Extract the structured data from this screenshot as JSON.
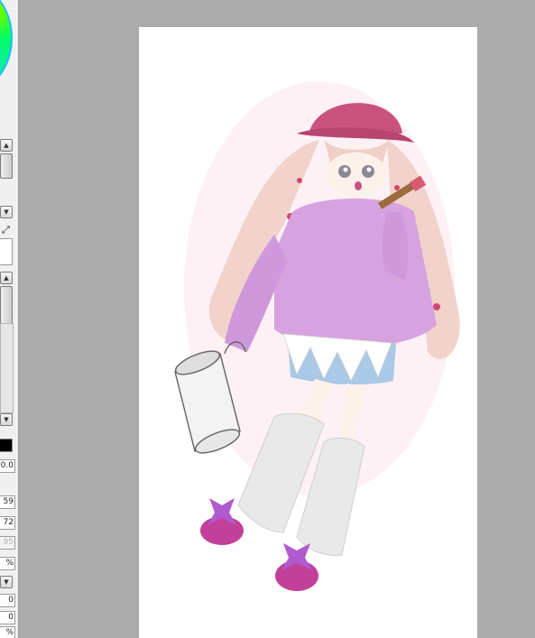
{
  "app": {
    "panel": {
      "fields": [
        {
          "value": "0.0",
          "enabled": true
        },
        {
          "value": "59",
          "enabled": true
        },
        {
          "value": "72",
          "enabled": true
        },
        {
          "value": "95",
          "enabled": false
        },
        {
          "value": "%",
          "enabled": true
        },
        {
          "value": "0",
          "enabled": true
        },
        {
          "value": "0",
          "enabled": true
        },
        {
          "value": "%",
          "enabled": true
        }
      ],
      "primary_color": "#000000"
    },
    "canvas": {
      "background": "#ababab",
      "paper_color": "#ffffff"
    },
    "icons": {
      "scroll_up": "scroll-up-icon",
      "scroll_down": "scroll-down-icon",
      "swap": "swap-colors-icon"
    },
    "colors": {
      "hat": "#c9527e",
      "sweater": "#d6a3e0",
      "shorts": "#a9c9e6",
      "hair": "#f0cfc6",
      "ribbon": "#b05acd",
      "shoes": "#c23f9a"
    }
  }
}
